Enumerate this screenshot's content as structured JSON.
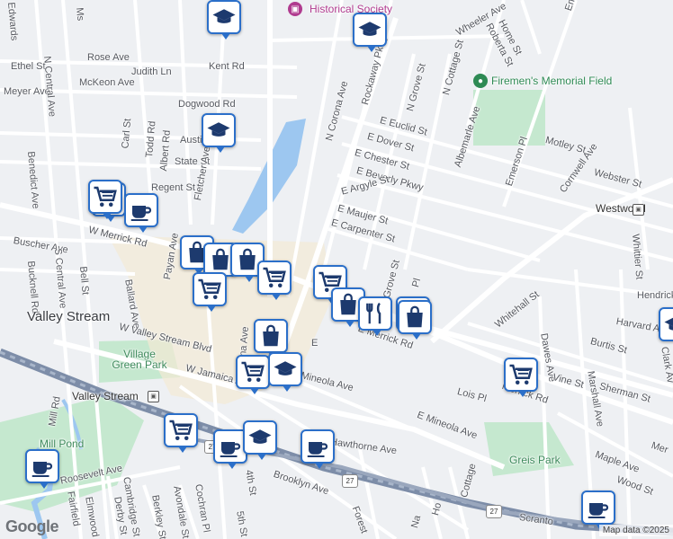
{
  "map": {
    "attribution": "Map data ©2025",
    "logo": "Google",
    "street_labels": [
      "Rose Ave",
      "Ethel St",
      "Meyer Ave",
      "Judith Ln",
      "Kent Rd",
      "McKeon Ave",
      "Dogwood Rd",
      "N Central Ave",
      "Benedict Ave",
      "Carl St",
      "Todd Rd",
      "Albert Rd",
      "Austin St",
      "State St",
      "Fletcher Ave",
      "Regent St",
      "Buscher Ave",
      "W Merrick Rd",
      "Bucknell Rd",
      "S Central Ave",
      "Bell St",
      "Ballard Ave",
      "Payan Ave",
      "Corona Ave",
      "N Corona Ave",
      "Rockaway Pkwy",
      "Wheeler Ave",
      "Roberta St",
      "Home St",
      "Emerson Pl",
      "N Grove St",
      "N Cottage St",
      "E Euclid St",
      "E Dover St",
      "E Chester St",
      "E Beverly Pkwy",
      "E Argyle St",
      "E Maujer St",
      "E Carpenter St",
      "Albemarle Ave",
      "Motley St",
      "Webster St",
      "Cornwell Ave",
      "Hendrick",
      "Harvard Av",
      "Whitehall St",
      "Whittier St",
      "Burtis St",
      "Dawes Ave",
      "Vine St",
      "Marshall Ave",
      "Sherman St",
      "Clark Av",
      "Lois Pl",
      "E Merrick Rd",
      "Merrick Rd",
      "Mer",
      "W Valley Stream Blvd",
      "W Jamaica Ave",
      "E Mineola Ave",
      "Mineola Ave",
      "Mill Rd",
      "Hawthorne Ave",
      "Brooklyn Ave",
      "Roosevelt Ave",
      "Fairfield",
      "Elmwood",
      "Cambridge St",
      "Derby St",
      "Berkley St",
      "Avondale St",
      "Cochran Pl",
      "4th St",
      "5th St",
      "Scranto",
      "Maple Ave",
      "Wood St",
      "Forest",
      "Edwards",
      "Grove St",
      "Cottage",
      "Ho",
      "Na",
      "Ms",
      "Emers",
      "Pl",
      "E"
    ],
    "places": {
      "city": "Valley Stream",
      "village_green": "Village Green Park",
      "mill_pond": "Mill Pond",
      "greis_park": "Greis Park",
      "firemens": "Firemen's Memorial Field",
      "historical": "Historical Society",
      "station_valley": "Valley Stream",
      "station_westwood": "Westwood"
    },
    "route_shields": [
      "27",
      "27",
      "27"
    ],
    "markers": [
      {
        "icon": "cart"
      },
      {
        "icon": "coffee"
      },
      {
        "icon": "bag"
      },
      {
        "icon": "bag"
      },
      {
        "icon": "bag"
      },
      {
        "icon": "cart"
      },
      {
        "icon": "cart"
      },
      {
        "icon": "bag"
      },
      {
        "icon": "cart"
      },
      {
        "icon": "bag"
      },
      {
        "icon": "fork-knife"
      },
      {
        "icon": "bag"
      },
      {
        "icon": "bag"
      },
      {
        "icon": "cart"
      },
      {
        "icon": "cap"
      },
      {
        "icon": "cap"
      },
      {
        "icon": "cap"
      },
      {
        "icon": "cap"
      },
      {
        "icon": "cart"
      },
      {
        "icon": "coffee"
      },
      {
        "icon": "coffee"
      },
      {
        "icon": "coffee"
      },
      {
        "icon": "cap"
      },
      {
        "icon": "coffee"
      },
      {
        "icon": "cart"
      },
      {
        "icon": "cart"
      },
      {
        "icon": "cap"
      }
    ]
  },
  "colors": {
    "land": "#eef0f3",
    "road": "#ffffff",
    "highway": "#8e9bb2",
    "rail": "#7d8da8",
    "water": "#9dc7f0",
    "park": "#c5e8cf",
    "downtown": "#f4e9d4",
    "marker_border": "#2b6fc9"
  }
}
